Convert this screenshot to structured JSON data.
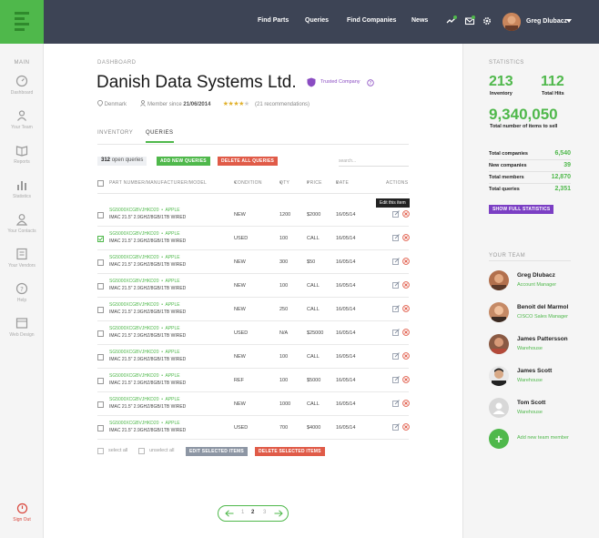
{
  "nav": {
    "links": [
      "Find Parts",
      "Queries",
      "Find Companies",
      "News"
    ],
    "user_name": "Greg Dlubacz"
  },
  "sidebar": {
    "section": "MAIN",
    "items": [
      {
        "label": "Dashboard",
        "icon": "dashboard-icon"
      },
      {
        "label": "Your Team",
        "icon": "team-icon"
      },
      {
        "label": "Reports",
        "icon": "reports-icon"
      },
      {
        "label": "Statistics",
        "icon": "statistics-icon"
      },
      {
        "label": "Your Contacts",
        "icon": "contacts-icon"
      },
      {
        "label": "Your Vendors",
        "icon": "vendors-icon"
      },
      {
        "label": "Help",
        "icon": "help-icon"
      },
      {
        "label": "Web Design",
        "icon": "web-design-icon"
      }
    ],
    "sign_out": "Sign Out"
  },
  "page": {
    "breadcrumb": "DASHBOARD",
    "title": "Danish Data Systems Ltd.",
    "trusted": "Trusted Company",
    "location": "Denmark",
    "member_since_label": "Member since",
    "member_since": "21/06/2014",
    "rating": 3.5,
    "recommendations": "(21 recommendations)"
  },
  "tabs": [
    {
      "label": "INVENTORY",
      "active": false
    },
    {
      "label": "QUERIES",
      "active": true
    }
  ],
  "toolbar": {
    "count": "312",
    "count_label": "open queries",
    "add_label": "ADD NEW QUERIES",
    "delete_all_label": "DELETE ALL QUERIES",
    "search_placeholder": "search..."
  },
  "table": {
    "headers": {
      "part": "PART NUMBER/MANUFACTURER/MODEL",
      "condition": "CONDITION",
      "qty": "QTY",
      "price": "PRICE",
      "date": "DATE",
      "actions": "ACTIONS"
    },
    "tooltip": "Edit this item",
    "rows": [
      {
        "pn": "SG5000XCGBVJHKD20",
        "mfr": "APPLE",
        "model": "IMAC 21.5\" 2.9GHZ/8GB/1TB WIRED",
        "condition": "NEW",
        "qty": "1200",
        "price": "$2000",
        "date": "16/05/14",
        "checked": false
      },
      {
        "pn": "SG5000XCGBVJHKD20",
        "mfr": "APPLE",
        "model": "IMAC 21.5\" 2.9GHZ/8GB/1TB WIRED",
        "condition": "USED",
        "qty": "100",
        "price": "CALL",
        "date": "16/05/14",
        "checked": true
      },
      {
        "pn": "SG5000XCGBVJHKD20",
        "mfr": "APPLE",
        "model": "IMAC 21.5\" 2.9GHZ/8GB/1TB WIRED",
        "condition": "NEW",
        "qty": "300",
        "price": "$50",
        "date": "16/05/14",
        "checked": false
      },
      {
        "pn": "SG5000XCGBVJHKD20",
        "mfr": "APPLE",
        "model": "IMAC 21.5\" 2.9GHZ/8GB/1TB WIRED",
        "condition": "NEW",
        "qty": "100",
        "price": "CALL",
        "date": "16/05/14",
        "checked": false
      },
      {
        "pn": "SG5000XCGBVJHKD20",
        "mfr": "APPLE",
        "model": "IMAC 21.5\" 2.9GHZ/8GB/1TB WIRED",
        "condition": "NEW",
        "qty": "250",
        "price": "CALL",
        "date": "16/05/14",
        "checked": false
      },
      {
        "pn": "SG5000XCGBVJHKD20",
        "mfr": "APPLE",
        "model": "IMAC 21.5\" 2.9GHZ/8GB/1TB WIRED",
        "condition": "USED",
        "qty": "N/A",
        "price": "$25000",
        "date": "16/05/14",
        "checked": false
      },
      {
        "pn": "SG5000XCGBVJHKD20",
        "mfr": "APPLE",
        "model": "IMAC 21.5\" 2.9GHZ/8GB/1TB WIRED",
        "condition": "NEW",
        "qty": "100",
        "price": "CALL",
        "date": "16/05/14",
        "checked": false
      },
      {
        "pn": "SG5000XCGBVJHKD20",
        "mfr": "APPLE",
        "model": "IMAC 21.5\" 2.9GHZ/8GB/1TB WIRED",
        "condition": "REF",
        "qty": "100",
        "price": "$5000",
        "date": "16/05/14",
        "checked": false
      },
      {
        "pn": "SG5000XCGBVJHKD20",
        "mfr": "APPLE",
        "model": "IMAC 21.5\" 2.9GHZ/8GB/1TB WIRED",
        "condition": "NEW",
        "qty": "1000",
        "price": "CALL",
        "date": "16/05/14",
        "checked": false
      },
      {
        "pn": "SG5000XCGBVJHKD20",
        "mfr": "APPLE",
        "model": "IMAC 21.5\" 2.9GHZ/8GB/1TB WIRED",
        "condition": "USED",
        "qty": "700",
        "price": "$4000",
        "date": "16/05/14",
        "checked": false
      }
    ]
  },
  "bulk": {
    "select_all": "select all",
    "unselect_all": "unselect all",
    "edit_selected": "EDIT SELECTED ITEMS",
    "delete_selected": "DELETE SELECTED ITEMS"
  },
  "pagination": {
    "pages": [
      "1",
      "2",
      "3"
    ],
    "current": "2"
  },
  "stats": {
    "heading": "STATISTICS",
    "inventory": "213",
    "inventory_label": "Inventory",
    "total_hits": "112",
    "total_hits_label": "Total Hits",
    "items_to_sell": "9,340,050",
    "items_to_sell_label": "Total number of items to sell",
    "rows": [
      {
        "label": "Total companies",
        "value": "6,540"
      },
      {
        "label": "New companies",
        "value": "39"
      },
      {
        "label": "Total members",
        "value": "12,870"
      },
      {
        "label": "Total queries",
        "value": "2,351"
      }
    ],
    "full_button": "SHOW FULL STATISTICS"
  },
  "team": {
    "heading": "YOUR TEAM",
    "members": [
      {
        "name": "Greg Dlubacz",
        "role": "Account Manager"
      },
      {
        "name": "Benoit del Marmol",
        "role": "CISCO Sales Manager"
      },
      {
        "name": "James Pattersson",
        "role": "Warehouse"
      },
      {
        "name": "James Scott",
        "role": "Warehouse"
      },
      {
        "name": "Tom Scott",
        "role": "Warehouse"
      }
    ],
    "add_label": "Add new team member"
  },
  "colors": {
    "accent": "#4fb84b",
    "danger": "#e05b48",
    "topbar": "#3d4455",
    "purple": "#7b3fc4"
  }
}
